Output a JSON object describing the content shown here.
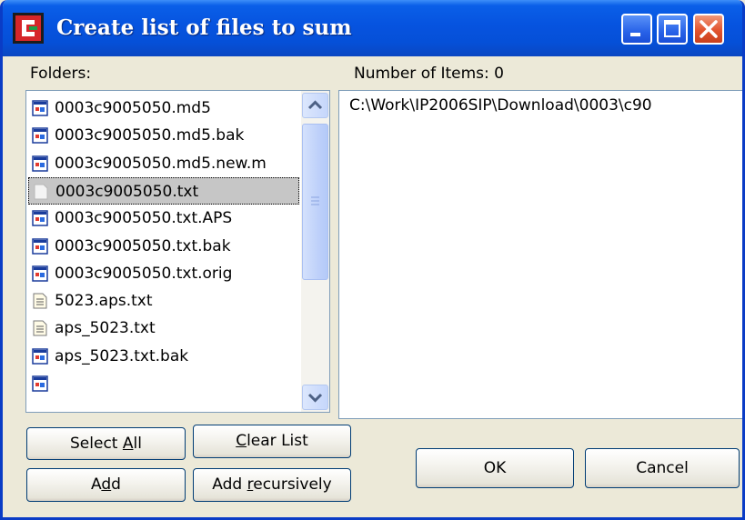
{
  "window": {
    "title": "Create list of files to sum"
  },
  "folders_label": "Folders:",
  "number_of_items_label": "Number of Items: 0",
  "files": [
    {
      "name": "0003c9005050.md5",
      "icon": "exe-file-icon",
      "selected": false
    },
    {
      "name": "0003c9005050.md5.bak",
      "icon": "exe-file-icon",
      "selected": false
    },
    {
      "name": "0003c9005050.md5.new.m",
      "icon": "exe-file-icon",
      "selected": false
    },
    {
      "name": "0003c9005050.txt",
      "icon": "blank-file-icon",
      "selected": true
    },
    {
      "name": "0003c9005050.txt.APS",
      "icon": "exe-file-icon",
      "selected": false
    },
    {
      "name": "0003c9005050.txt.bak",
      "icon": "exe-file-icon",
      "selected": false
    },
    {
      "name": "0003c9005050.txt.orig",
      "icon": "exe-file-icon",
      "selected": false
    },
    {
      "name": "5023.aps.txt",
      "icon": "text-file-icon",
      "selected": false
    },
    {
      "name": "aps_5023.txt",
      "icon": "text-file-icon",
      "selected": false
    },
    {
      "name": "aps_5023.txt.bak",
      "icon": "exe-file-icon",
      "selected": false
    },
    {
      "name": "",
      "icon": "exe-file-icon",
      "selected": false
    }
  ],
  "path": "C:\\Work\\IP2006SIP\\Download\\0003\\c90",
  "buttons": {
    "select_all": {
      "before": "Select ",
      "key": "A",
      "after": "ll"
    },
    "clear_list": {
      "before": "",
      "key": "C",
      "after": "lear List"
    },
    "add": {
      "before": "A",
      "key": "d",
      "after": "d"
    },
    "add_recursively": {
      "before": "Add ",
      "key": "r",
      "after": "ecursively"
    },
    "ok": "OK",
    "cancel": "Cancel"
  },
  "colors": {
    "title_bar": "#0653df",
    "close_button": "#e2532e",
    "selection": "#c6c6c6"
  }
}
